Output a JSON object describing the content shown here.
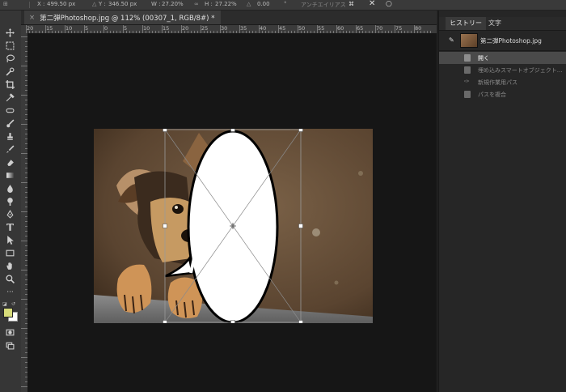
{
  "options_bar": {
    "x_label": "X :",
    "x_value": "499.50 px",
    "y_label": "Y :",
    "y_value": "346.50 px",
    "w_label": "W :",
    "w_value": "27.20%",
    "h_label": "H :",
    "h_value": "27.22%",
    "rotation_value": "0.00",
    "antialias": "アンチエイリアス"
  },
  "document_tab": {
    "title": "第二弾Photoshop.jpg @ 112% (00307_1, RGB/8#) *",
    "close": "×"
  },
  "ruler": {
    "h_labels": [
      "20",
      "15",
      "10",
      "5",
      "0",
      "5",
      "10",
      "15",
      "20",
      "25",
      "30",
      "35",
      "40",
      "45",
      "50",
      "55",
      "60",
      "65",
      "70",
      "75",
      "80"
    ]
  },
  "panel": {
    "tabs": [
      "ヒストリー",
      "文字"
    ],
    "snapshot_name": "第二弾Photoshop.jpg",
    "history": [
      {
        "label": "開く",
        "state": "active"
      },
      {
        "label": "埋め込みスマートオブジェクト...",
        "state": "dim"
      },
      {
        "label": "新規作業用パス",
        "state": "dim"
      },
      {
        "label": "パスを複合",
        "state": "dim"
      }
    ]
  },
  "colors": {
    "foreground": "#d7dc7a",
    "background": "#ffffff",
    "active_row": "#4a4a4a"
  }
}
